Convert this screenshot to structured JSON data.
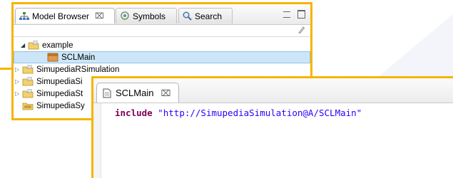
{
  "model_browser": {
    "tabs": [
      {
        "label": "Model Browser",
        "icon": "model-browser-icon",
        "close": "⌧"
      },
      {
        "label": "Symbols",
        "icon": "symbols-icon"
      },
      {
        "label": "Search",
        "icon": "search-icon"
      }
    ],
    "tree": [
      {
        "label": "example",
        "expanded": true,
        "icon": "project-folder-icon"
      },
      {
        "label": "SCLMain",
        "selected": true,
        "icon": "scl-module-icon"
      },
      {
        "label": "SimupediaRSimulation",
        "icon": "project-folder-icon"
      },
      {
        "label": "SimupediaSi",
        "icon": "project-folder-icon"
      },
      {
        "label": "SimupediaSt",
        "icon": "project-folder-icon"
      },
      {
        "label": "SimupediaSy",
        "icon": "library-folder-icon"
      }
    ]
  },
  "editor": {
    "tab_label": "SCLMain",
    "tab_close": "⌧",
    "code_keyword": "include",
    "code_string": "\"http://SimupediaSimulation@A/SCLMain\""
  },
  "colors": {
    "highlight_border": "#f5b400",
    "selection_bg": "#cde6f7",
    "keyword": "#7f0055",
    "string": "#2a00ff"
  }
}
